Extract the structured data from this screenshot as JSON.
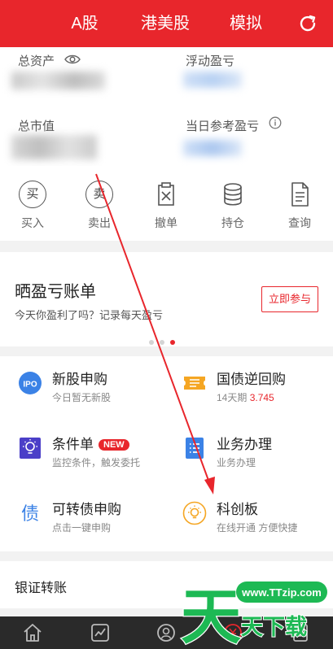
{
  "header": {
    "tabs": [
      {
        "label": "A股"
      },
      {
        "label": "港美股"
      },
      {
        "label": "模拟"
      }
    ],
    "refresh_icon": "refresh-icon"
  },
  "assets": {
    "total_assets_label": "总资产",
    "floating_pl_label": "浮动盈亏",
    "market_value_label": "总市值",
    "daily_pl_label": "当日参考盈亏"
  },
  "quick_actions": [
    {
      "label": "买入",
      "glyph": "买"
    },
    {
      "label": "卖出",
      "glyph": "卖"
    },
    {
      "label": "撤单"
    },
    {
      "label": "持仓"
    },
    {
      "label": "查询"
    }
  ],
  "banner": {
    "title": "晒盈亏账单",
    "subtitle": "今天你盈利了吗？记录每天盈亏",
    "join_label": "立即参与"
  },
  "services": [
    {
      "title": "新股申购",
      "subtitle": "今日暂无新股",
      "icon_text": "IPO"
    },
    {
      "title": "国债逆回购",
      "subtitle_prefix": "14天期",
      "subtitle_value": "3.745"
    },
    {
      "title": "条件单",
      "badge": "NEW",
      "subtitle": "监控条件，触发委托"
    },
    {
      "title": "业务办理",
      "subtitle": "业务办理"
    },
    {
      "title": "可转债申购",
      "subtitle": "点击一键申购",
      "icon_text": "债"
    },
    {
      "title": "科创板",
      "subtitle": "在线开通 方便快捷"
    }
  ],
  "bank_transfer": {
    "label": "银证转账"
  },
  "watermark": {
    "url": "www.TTzip.com",
    "big_char": "天",
    "text": "天下载"
  },
  "colors": {
    "brand_red": "#e8262c",
    "green": "#1db954",
    "orange": "#f5a623",
    "blue": "#3b82e6",
    "purple": "#4b3fc8"
  }
}
